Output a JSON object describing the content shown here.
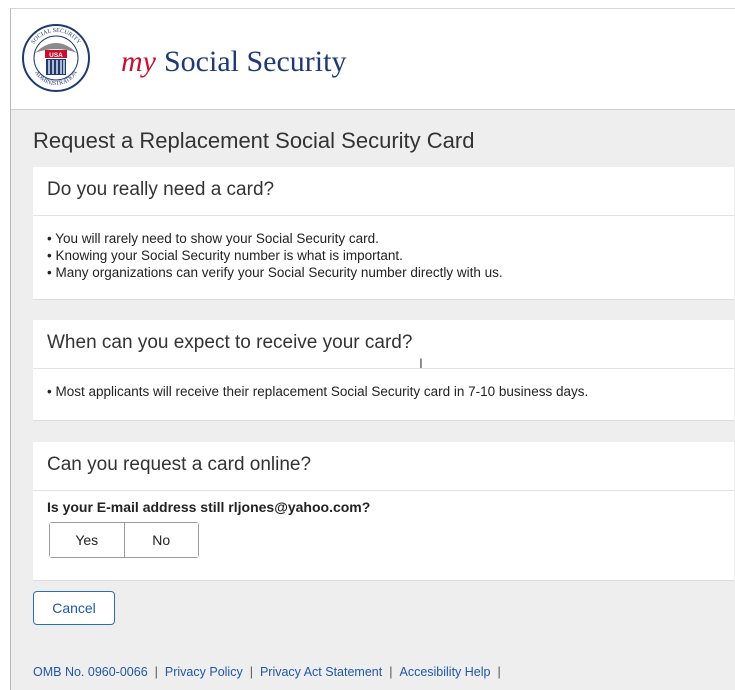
{
  "header": {
    "brand_my": "my",
    "brand_rest": "Social Security",
    "seal_text_top": "SOCIAL SECURITY",
    "seal_text_bottom": "ADMINISTRATION",
    "seal_badge": "USA"
  },
  "page_title": "Request a Replacement Social Security Card",
  "sections": [
    {
      "heading": "Do you really need a card?",
      "lines": [
        "• You will rarely need to show your Social Security card.",
        "• Knowing your Social Security number is what is important.",
        "• Many organizations can verify your Social Security number directly with us."
      ]
    },
    {
      "heading": "When can you expect to receive your card?",
      "lines": [
        "• Most applicants will receive their replacement Social Security card in 7-10 business days."
      ]
    },
    {
      "heading": "Can you request a card online?",
      "question": "Is your E-mail address still rljones@yahoo.com?",
      "options": [
        "Yes",
        "No"
      ]
    }
  ],
  "cancel_label": "Cancel",
  "footer": {
    "links": [
      "OMB No. 0960-0066",
      "Privacy Policy",
      "Privacy Act Statement",
      "Accesibility Help"
    ],
    "separator": "|"
  },
  "colors": {
    "brand_blue": "#1f3a73",
    "brand_red": "#c8102e",
    "link_blue": "#1f57a8",
    "panel_gray": "#eeeeee"
  }
}
